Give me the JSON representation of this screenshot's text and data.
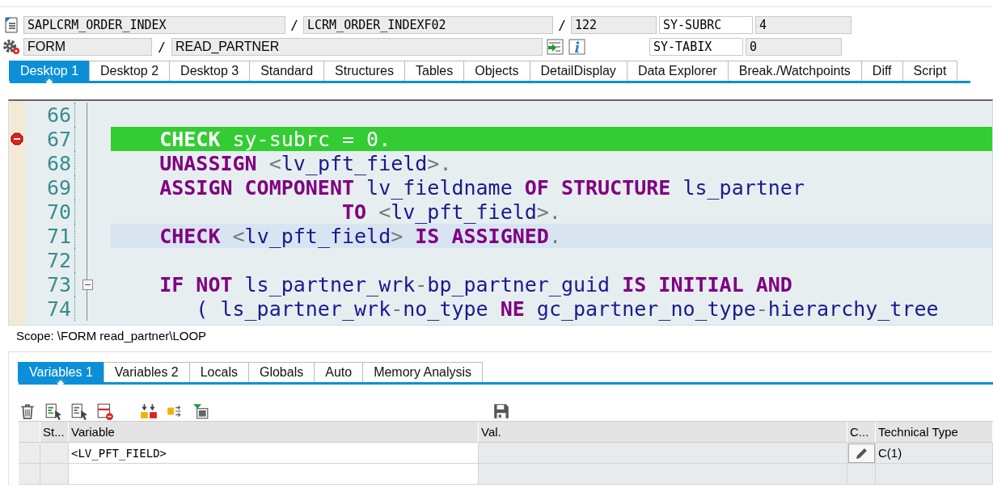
{
  "program": {
    "main": "SAPLCRM_ORDER_INDEX",
    "include": "LCRM_ORDER_INDEXF02",
    "line": "122"
  },
  "event": {
    "type": "FORM",
    "name": "READ_PARTNER"
  },
  "separators": [
    "/",
    "/",
    "/"
  ],
  "system_fields": [
    {
      "name": "SY-SUBRC",
      "value": "4"
    },
    {
      "name": "SY-TABIX",
      "value": "0"
    }
  ],
  "desktop_tabs": [
    {
      "label": "Desktop 1",
      "selected": true
    },
    {
      "label": "Desktop 2",
      "selected": false
    },
    {
      "label": "Desktop 3",
      "selected": false
    },
    {
      "label": "Standard",
      "selected": false
    },
    {
      "label": "Structures",
      "selected": false
    },
    {
      "label": "Tables",
      "selected": false
    },
    {
      "label": "Objects",
      "selected": false
    },
    {
      "label": "DetailDisplay",
      "selected": false
    },
    {
      "label": "Data Explorer",
      "selected": false
    },
    {
      "label": "Break./Watchpoints",
      "selected": false
    },
    {
      "label": "Diff",
      "selected": false
    },
    {
      "label": "Script",
      "selected": false
    }
  ],
  "code": {
    "lines": [
      {
        "number": "66",
        "current": false,
        "cursor": false,
        "breakpoint": false,
        "fold": false
      },
      {
        "number": "67",
        "current": true,
        "cursor": false,
        "breakpoint": true,
        "fold": false,
        "tokens": [
          {
            "kind": "kw",
            "text": "    CHECK"
          },
          {
            "kind": "id",
            "text": " sy-subrc "
          },
          {
            "kind": "op",
            "text": "="
          },
          {
            "kind": "id",
            "text": " 0"
          },
          {
            "kind": "op",
            "text": "."
          }
        ]
      },
      {
        "number": "68",
        "current": false,
        "cursor": false,
        "breakpoint": false,
        "fold": false,
        "tokens": [
          {
            "kind": "kw",
            "text": "    UNASSIGN"
          },
          {
            "kind": "op",
            "text": " <"
          },
          {
            "kind": "id",
            "text": "lv_pft_field"
          },
          {
            "kind": "op",
            "text": ">."
          }
        ]
      },
      {
        "number": "69",
        "current": false,
        "cursor": false,
        "breakpoint": false,
        "fold": false,
        "tokens": [
          {
            "kind": "kw",
            "text": "    ASSIGN COMPONENT"
          },
          {
            "kind": "id",
            "text": " lv_fieldname "
          },
          {
            "kind": "kw",
            "text": "OF STRUCTURE"
          },
          {
            "kind": "id",
            "text": " ls_partner"
          }
        ]
      },
      {
        "number": "70",
        "current": false,
        "cursor": false,
        "breakpoint": false,
        "fold": false,
        "tokens": [
          {
            "kind": "kw",
            "text": "                   TO"
          },
          {
            "kind": "op",
            "text": " <"
          },
          {
            "kind": "id",
            "text": "lv_pft_field"
          },
          {
            "kind": "op",
            "text": ">."
          }
        ]
      },
      {
        "number": "71",
        "current": false,
        "cursor": true,
        "breakpoint": false,
        "fold": false,
        "tokens": [
          {
            "kind": "kw",
            "text": "    CHECK"
          },
          {
            "kind": "op",
            "text": " <"
          },
          {
            "kind": "id",
            "text": "lv_pft_field"
          },
          {
            "kind": "op",
            "text": "> "
          },
          {
            "kind": "kw",
            "text": "IS ASSIGNED"
          },
          {
            "kind": "op",
            "text": "."
          }
        ]
      },
      {
        "number": "72",
        "current": false,
        "cursor": false,
        "breakpoint": false,
        "fold": false
      },
      {
        "number": "73",
        "current": false,
        "cursor": false,
        "breakpoint": false,
        "fold": true,
        "tokens": [
          {
            "kind": "kw",
            "text": "    IF NOT"
          },
          {
            "kind": "id",
            "text": " ls_partner_wrk"
          },
          {
            "kind": "op",
            "text": "-"
          },
          {
            "kind": "id",
            "text": "bp_partner_guid "
          },
          {
            "kind": "kw",
            "text": "IS INITIAL AND"
          }
        ]
      },
      {
        "number": "74",
        "current": false,
        "cursor": false,
        "breakpoint": false,
        "fold": false,
        "tokens": [
          {
            "kind": "id",
            "text": "       ( ls_partner_wrk"
          },
          {
            "kind": "op",
            "text": "-"
          },
          {
            "kind": "id",
            "text": "no_type "
          },
          {
            "kind": "kw",
            "text": "NE"
          },
          {
            "kind": "id",
            "text": " gc_partner_no_type"
          },
          {
            "kind": "op",
            "text": "-"
          },
          {
            "kind": "id",
            "text": "hierarchy_tree"
          }
        ]
      }
    ]
  },
  "scope": "Scope: \\FORM read_partner\\LOOP",
  "variable_tabs": [
    {
      "label": "Variables 1",
      "selected": true
    },
    {
      "label": "Variables 2",
      "selected": false
    },
    {
      "label": "Locals",
      "selected": false
    },
    {
      "label": "Globals",
      "selected": false
    },
    {
      "label": "Auto",
      "selected": false
    },
    {
      "label": "Memory Analysis",
      "selected": false
    }
  ],
  "table": {
    "columns": [
      "St...",
      "Variable",
      "Val.",
      "C...",
      "Technical Type"
    ],
    "rows": [
      {
        "variable": "<LV_PFT_FIELD>",
        "change_button": true,
        "technical_type": "C(1)"
      }
    ]
  }
}
